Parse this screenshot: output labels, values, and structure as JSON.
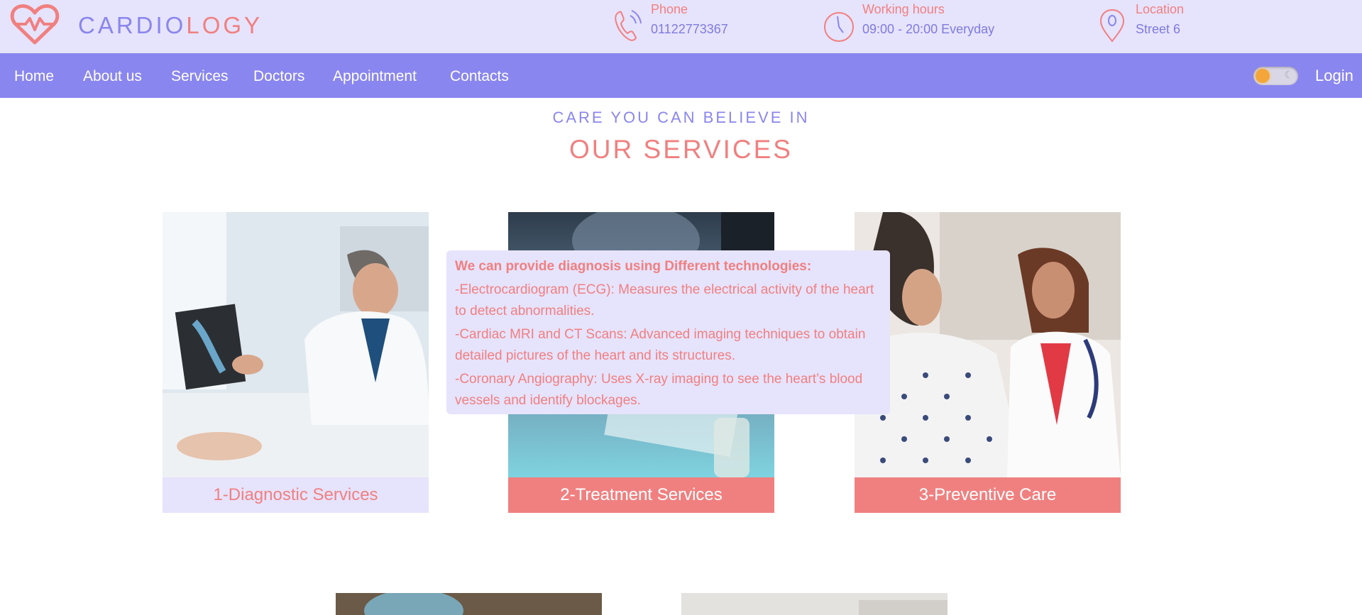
{
  "brand": {
    "part1": "CARDIO",
    "part2": "LOGY"
  },
  "contact": [
    {
      "label": "Phone",
      "value": "01122773367",
      "icon": "phone-icon"
    },
    {
      "label": "Working hours",
      "value": "09:00 - 20:00 Everyday",
      "icon": "clock-icon"
    },
    {
      "label": "Location",
      "value": "Street 6",
      "icon": "location-pin-icon"
    }
  ],
  "nav": {
    "items": [
      "Home",
      "About us",
      "Services",
      "Doctors",
      "Appointment",
      "Contacts"
    ],
    "login": "Login"
  },
  "colors": {
    "lavender": "#e6e3fc",
    "purple": "#8a86ef",
    "salmon": "#f08080"
  },
  "section": {
    "eyebrow": "CARE YOU CAN BELIEVE IN",
    "title": "OUR SERVICES"
  },
  "services": [
    {
      "caption": "1-Diagnostic Services"
    },
    {
      "caption": "2-Treatment Services"
    },
    {
      "caption": "3-Preventive Care"
    }
  ],
  "tooltip": {
    "title": "We can provide diagnosis using Different technologies:",
    "lines": [
      "-Electrocardiogram (ECG): Measures the electrical activity of the heart to detect abnormalities.",
      "-Cardiac MRI and CT Scans: Advanced imaging techniques to obtain detailed pictures of the heart and its structures.",
      "-Coronary Angiography: Uses X-ray imaging to see the heart’s blood vessels and identify blockages."
    ]
  }
}
